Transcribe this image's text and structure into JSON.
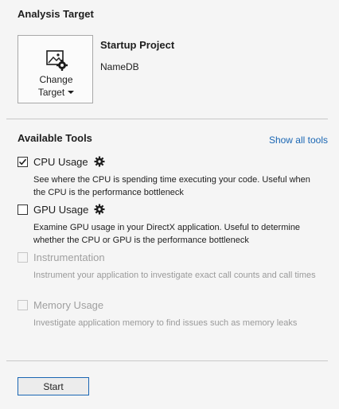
{
  "analysis_target": {
    "section_title": "Analysis Target",
    "change_target_line1": "Change",
    "change_target_line2": "Target",
    "startup_project_title": "Startup Project",
    "startup_project_name": "NameDB"
  },
  "available_tools": {
    "section_title": "Available Tools",
    "show_all_label": "Show all tools",
    "link_color": "#1a66b3",
    "tools": [
      {
        "name": "CPU Usage",
        "checked": true,
        "enabled": true,
        "has_settings": true,
        "description": "See where the CPU is spending time executing your code. Useful when the CPU is the performance bottleneck"
      },
      {
        "name": "GPU Usage",
        "checked": false,
        "enabled": true,
        "has_settings": true,
        "description": "Examine GPU usage in your DirectX application. Useful to determine whether the CPU or GPU is the performance bottleneck"
      },
      {
        "name": "Instrumentation",
        "checked": false,
        "enabled": false,
        "has_settings": false,
        "description": "Instrument your application to investigate exact call counts and call times"
      },
      {
        "name": "Memory Usage",
        "checked": false,
        "enabled": false,
        "has_settings": false,
        "description": "Investigate application memory to find issues such as memory leaks"
      }
    ]
  },
  "footer": {
    "start_label": "Start"
  },
  "icons": {
    "change_target": "image-with-gear-icon",
    "settings": "gear-icon",
    "dropdown": "caret-down-icon",
    "check": "checkmark-icon"
  }
}
